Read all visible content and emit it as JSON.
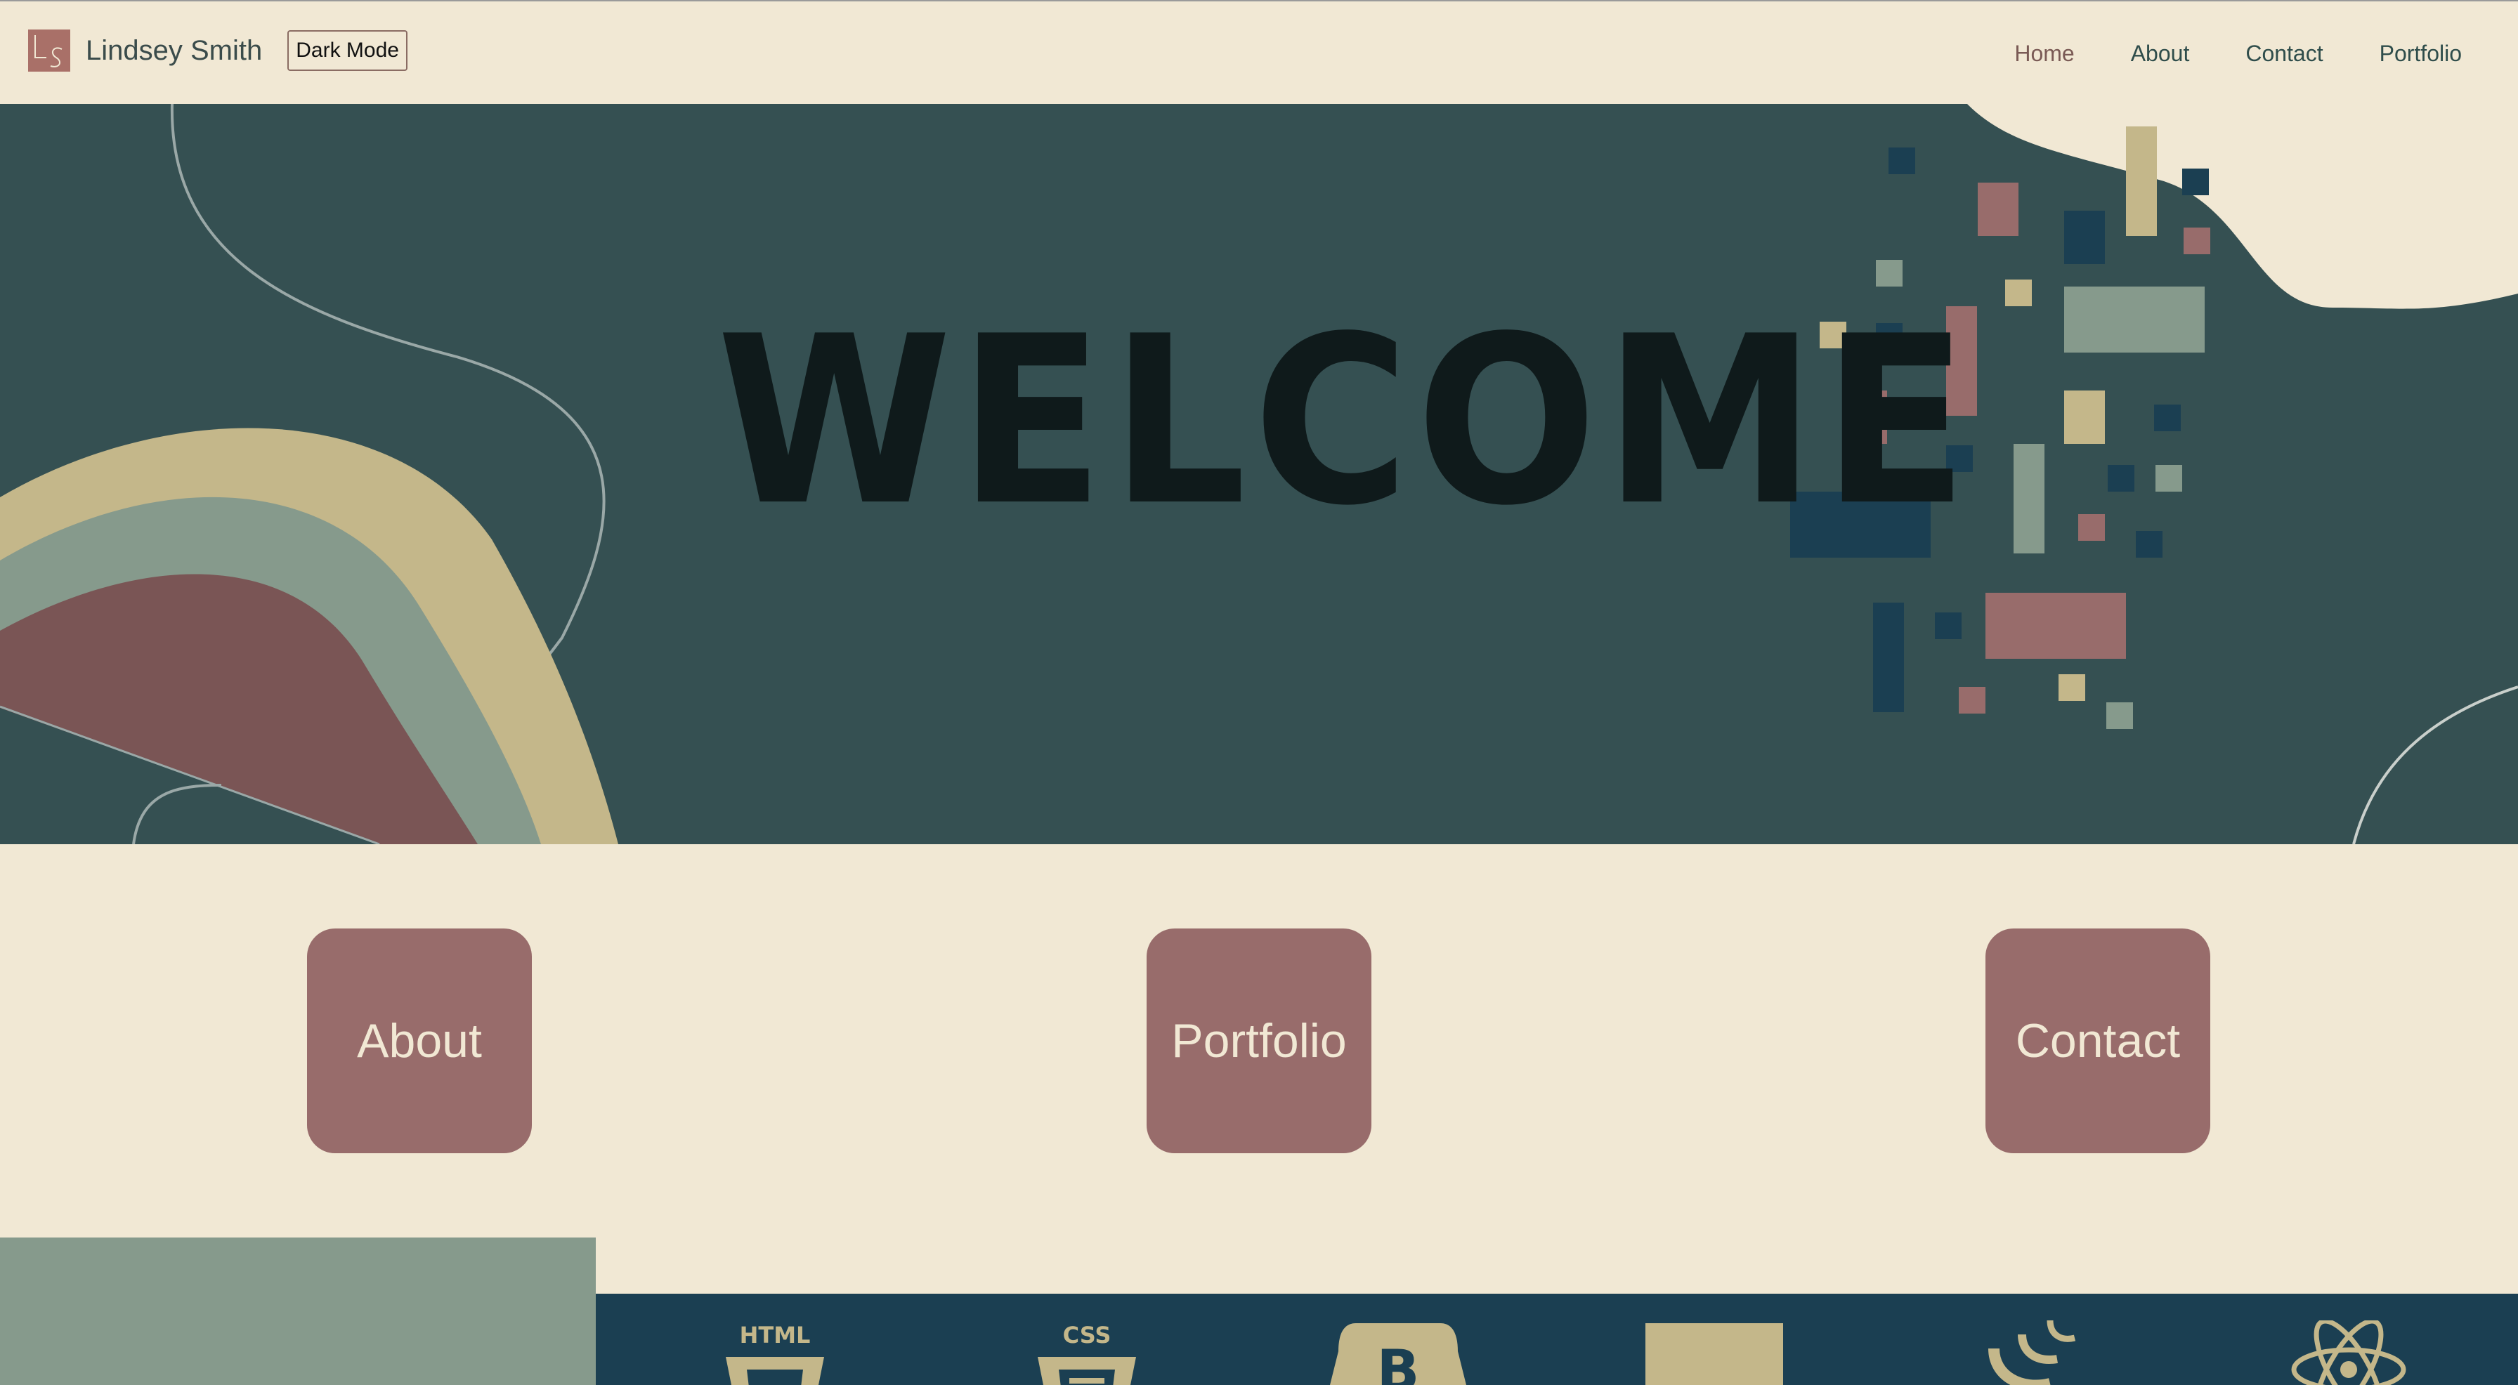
{
  "header": {
    "logo_text": "LS",
    "brand_name": "Lindsey Smith",
    "dark_mode_label": "Dark Mode",
    "nav": [
      {
        "label": "Home",
        "active": true
      },
      {
        "label": "About",
        "active": false
      },
      {
        "label": "Contact",
        "active": false
      },
      {
        "label": "Portfolio",
        "active": false
      }
    ]
  },
  "hero": {
    "title": "WELCOME"
  },
  "tiles": [
    {
      "label": "About"
    },
    {
      "label": "Portfolio"
    },
    {
      "label": "Contact"
    }
  ],
  "skills": {
    "html_label": "HTML",
    "css_label": "CSS",
    "bootstrap_label": "B",
    "items": [
      "html-icon",
      "css-icon",
      "bootstrap-icon",
      "js-icon",
      "jquery-icon",
      "react-icon"
    ]
  },
  "colors": {
    "cream": "#f1e8d4",
    "teal_dark": "#355052",
    "mauve": "#986c6b",
    "sage": "#869a8c",
    "sand": "#c4b78a",
    "navy": "#1b3f52"
  }
}
